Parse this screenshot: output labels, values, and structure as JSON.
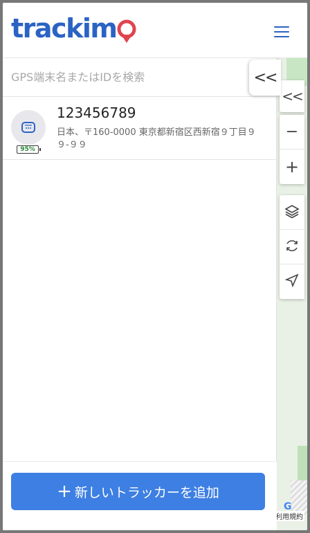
{
  "header": {
    "logo_text_left": "trackim",
    "menu_icon": "hamburger-icon"
  },
  "search": {
    "placeholder": "GPS端末名またはIDを検索",
    "value": ""
  },
  "collapse_button": {
    "label": "<<"
  },
  "map": {
    "collapse_label": "<<",
    "zoom_out_label": "−",
    "zoom_in_label": "+",
    "layers_icon": "layers-icon",
    "refresh_icon": "refresh-icon",
    "locate_icon": "navigation-arrow-icon",
    "terms_text": "利用規約"
  },
  "devices": [
    {
      "name": "123456789",
      "address": "日本、〒160-0000 東京都新宿区西新宿９丁目９９-９９",
      "battery": "95%",
      "icon": "tracker-device-icon"
    }
  ],
  "footer": {
    "add_plus": "+",
    "add_label": "新しいトラッカーを追加"
  },
  "colors": {
    "brand_blue": "#2b63c4",
    "button_blue": "#3d7fe3",
    "pin_red": "#e0444e",
    "battery_green": "#2e8b3e"
  }
}
